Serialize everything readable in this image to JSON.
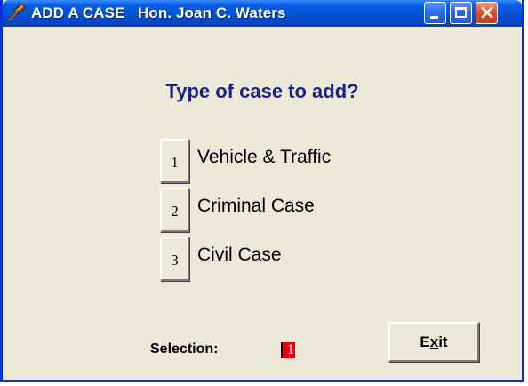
{
  "window": {
    "title": "ADD A CASE   Hon. Joan C. Waters",
    "icon": "gavel-icon"
  },
  "controls": {
    "minimize": "minimize-icon",
    "maximize": "maximize-icon",
    "close": "close-icon"
  },
  "main": {
    "prompt": "Type of case to add?",
    "options": [
      {
        "key": "1",
        "label": "Vehicle & Traffic"
      },
      {
        "key": "2",
        "label": "Criminal Case"
      },
      {
        "key": "3",
        "label": "Civil Case"
      }
    ]
  },
  "footer": {
    "selection_label": "Selection:",
    "selection_value": "1",
    "exit_label_pre": "E",
    "exit_label_access": "x",
    "exit_label_post": "it"
  },
  "colors": {
    "titlebar": "#0653D6",
    "window_bg": "#ECE9D8",
    "prompt_text": "#1A237E",
    "selection_highlight": "#E3000F"
  }
}
